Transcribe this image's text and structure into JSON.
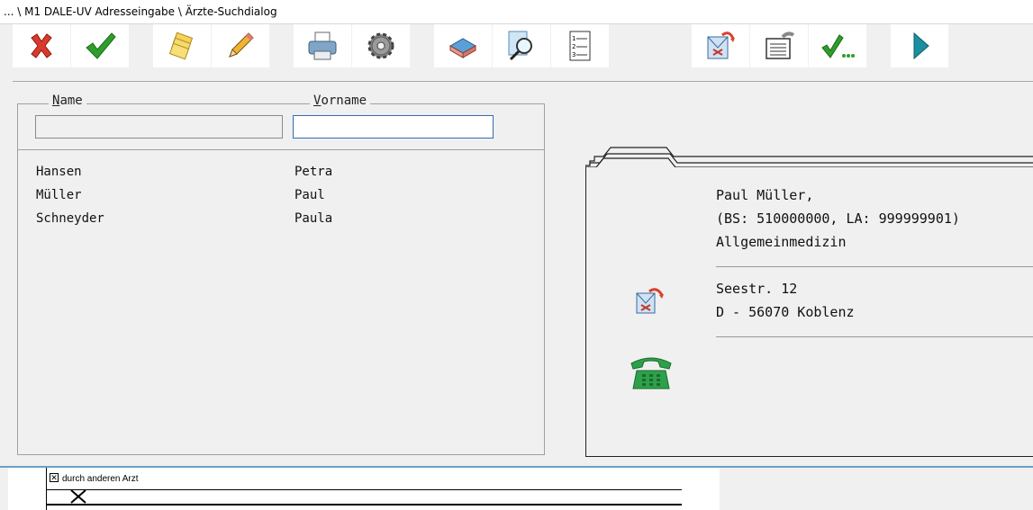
{
  "window": {
    "title": "... \\ M1 DALE-UV Adresseingabe \\ Ärzte-Suchdialog"
  },
  "toolbar": {
    "buttons": [
      {
        "name": "cancel-button",
        "icon": "red-x-icon"
      },
      {
        "name": "confirm-button",
        "icon": "green-check-icon"
      },
      {
        "name": "cards-button",
        "icon": "card-stack-icon"
      },
      {
        "name": "edit-button",
        "icon": "pencil-icon"
      },
      {
        "name": "print-button",
        "icon": "printer-icon"
      },
      {
        "name": "settings-button",
        "icon": "gear-icon"
      },
      {
        "name": "eraser-button",
        "icon": "eraser-icon"
      },
      {
        "name": "search-button",
        "icon": "magnifier-icon"
      },
      {
        "name": "list-button",
        "icon": "numbered-list-icon"
      },
      {
        "name": "bdt-mail-button",
        "icon": "bdt-envelope-icon"
      },
      {
        "name": "transfer-button",
        "icon": "document-transfer-icon"
      },
      {
        "name": "check-more-button",
        "icon": "check-ellipsis-icon"
      },
      {
        "name": "next-button",
        "icon": "play-arrow-icon"
      }
    ]
  },
  "search": {
    "name_label_first": "N",
    "name_label_rest": "ame",
    "vorname_label_first": "V",
    "vorname_label_rest": "orname",
    "name_value": "",
    "vorname_value": ""
  },
  "results": [
    {
      "name": "Hansen",
      "vorname": "Petra"
    },
    {
      "name": "Müller",
      "vorname": "Paul"
    },
    {
      "name": "Schneyder",
      "vorname": "Paula"
    }
  ],
  "detail": {
    "line1": "Paul Müller,",
    "line2": "(BS: 510000000, LA: 999999901)",
    "line3": "Allgemeinmedizin",
    "street": "Seestr. 12",
    "city": "D - 56070 Koblenz"
  },
  "doc": {
    "line1": "durch anderen Arzt"
  },
  "colors": {
    "accent": "#2f6fb5",
    "phone": "#2ea04a",
    "arrow": "#1a8fa0"
  }
}
